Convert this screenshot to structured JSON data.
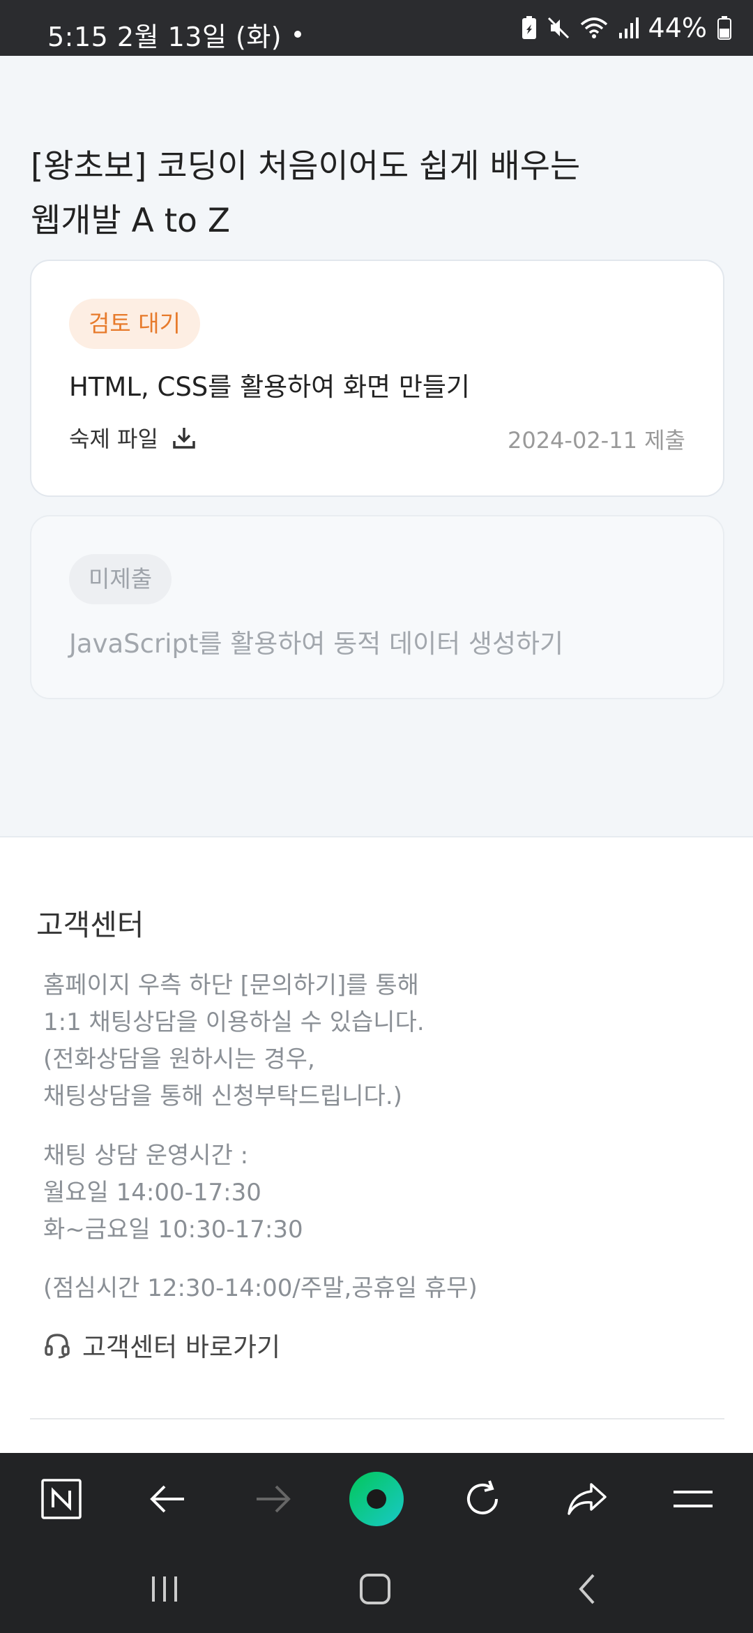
{
  "status_bar": {
    "time_date": "5:15   2월 13일 (화)",
    "battery": "44%"
  },
  "course": {
    "title": "[왕초보] 코딩이 처음이어도 쉽게 배우는 웹개발 A to Z"
  },
  "assignments": [
    {
      "status": "검토 대기",
      "title": "HTML, CSS를 활용하여 화면 만들기",
      "file_label": "숙제 파일",
      "submitted": "2024-02-11 제출"
    },
    {
      "status": "미제출",
      "title": "JavaScript를 활용하여 동적 데이터 생성하기"
    }
  ],
  "footer": {
    "heading": "고객센터",
    "info_lines": [
      "홈페이지 우측 하단 [문의하기]를 통해",
      "1:1 채팅상담을 이용하실 수 있습니다.",
      "(전화상담을 원하시는 경우,",
      "채팅상담을 통해 신청부탁드립니다.)"
    ],
    "hours_lines": [
      "채팅 상담 운영시간 :",
      "월요일 14:00-17:30",
      "화~금요일 10:30-17:30"
    ],
    "lunch": "(점심시간 12:30-14:00/주말,공휴일 휴무)",
    "link_label": "고객센터 바로가기"
  },
  "colors": {
    "review_badge_bg": "#fdeee3",
    "review_badge_text": "#e77a2b",
    "naver_green": "#03c75a"
  },
  "icons": {
    "toolbar": [
      "naver-n-icon",
      "back-arrow-icon",
      "forward-arrow-icon",
      "green-dot-icon",
      "refresh-icon",
      "share-icon",
      "menu-icon"
    ],
    "system_nav": [
      "recents-icon",
      "home-icon",
      "back-icon"
    ]
  }
}
